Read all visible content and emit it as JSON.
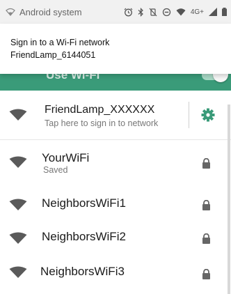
{
  "status_bar": {
    "app_name": "Android system",
    "network_type": "4G+"
  },
  "heads_up": {
    "title": "Sign in to a Wi-Fi network",
    "text": "FriendLamp_6144051"
  },
  "header": {
    "use_wifi_label": "Use Wi-Fi",
    "toggle_on": true
  },
  "networks": [
    {
      "ssid": "FriendLamp_XXXXXX",
      "subtitle": "Tap here to sign in to network",
      "locked": false,
      "has_settings": true
    },
    {
      "ssid": "YourWiFi",
      "subtitle": "Saved",
      "locked": true
    },
    {
      "ssid": "NeighborsWiFi1",
      "subtitle": "",
      "locked": true
    },
    {
      "ssid": "NeighborsWiFi2",
      "subtitle": "",
      "locked": true
    },
    {
      "ssid": "NeighborsWiFi3",
      "subtitle": "",
      "locked": true
    }
  ],
  "colors": {
    "accent": "#3a9b79"
  }
}
